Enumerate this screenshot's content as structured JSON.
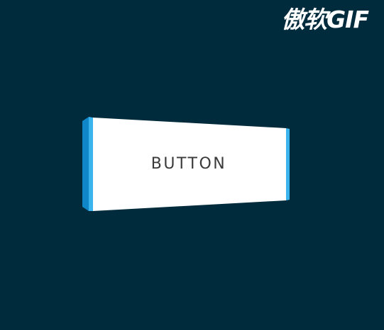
{
  "watermark": {
    "text": "傲软GIF"
  },
  "button": {
    "label": "BUTTON"
  },
  "colors": {
    "background": "#002b3c",
    "button_face": "#ffffff",
    "button_side_dark": "#0f86c8",
    "button_side_light": "#3bb4ee",
    "label_text": "#3a3a3a"
  }
}
